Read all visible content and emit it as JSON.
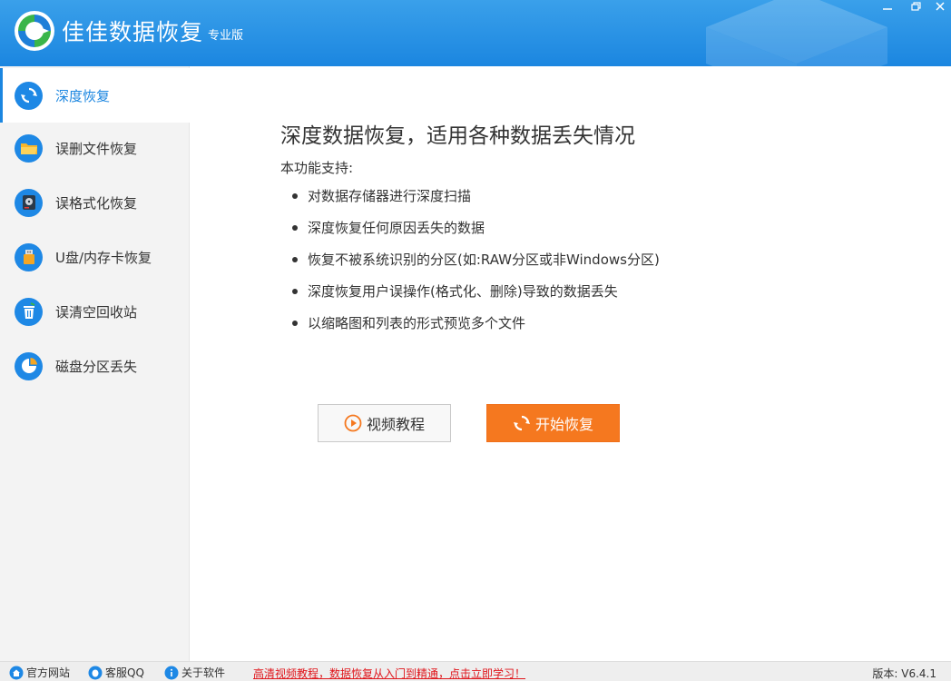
{
  "app": {
    "title": "佳佳数据恢复",
    "edition": "专业版",
    "accent_color": "#1b86e0",
    "start_button_color": "#f5781f"
  },
  "window_controls": [
    {
      "name": "minimize-icon"
    },
    {
      "name": "maximize-icon"
    },
    {
      "name": "close-icon"
    }
  ],
  "sidebar": {
    "items": [
      {
        "label": "深度恢复",
        "icon": "refresh-icon",
        "active": true
      },
      {
        "label": "误删文件恢复",
        "icon": "folder-icon",
        "active": false
      },
      {
        "label": "误格式化恢复",
        "icon": "disk-icon",
        "active": false
      },
      {
        "label": "U盘/内存卡恢复",
        "icon": "usb-icon",
        "active": false
      },
      {
        "label": "误清空回收站",
        "icon": "recycle-bin-icon",
        "active": false
      },
      {
        "label": "磁盘分区丢失",
        "icon": "pie-chart-icon",
        "active": false
      }
    ]
  },
  "main": {
    "heading": "深度数据恢复，适用各种数据丢失情况",
    "subhead": "本功能支持:",
    "features": [
      "对数据存储器进行深度扫描",
      "深度恢复任何原因丢失的数据",
      "恢复不被系统识别的分区(如:RAW分区或非Windows分区)",
      "深度恢复用户误操作(格式化、删除)导致的数据丢失",
      "以缩略图和列表的形式预览多个文件"
    ],
    "video_button": "视频教程",
    "start_button": "开始恢复"
  },
  "footer": {
    "website": "官方网站",
    "support_qq": "客服QQ",
    "about": "关于软件",
    "promo": "高清视频教程，数据恢复从入门到精通，点击立即学习！",
    "version": "版本: V6.4.1"
  }
}
